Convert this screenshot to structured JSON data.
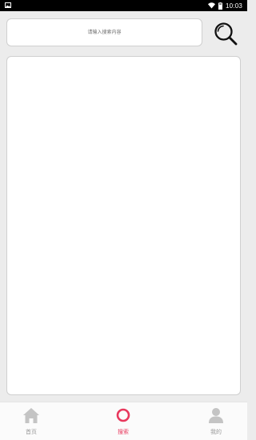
{
  "status_bar": {
    "time": "10:03",
    "icons": [
      "image-icon",
      "wifi-icon",
      "battery-icon"
    ]
  },
  "search": {
    "placeholder": "请输入搜索内容",
    "value": "",
    "button_icon": "search-icon"
  },
  "bottom_nav": {
    "items": [
      {
        "label": "首页",
        "icon": "home-icon",
        "active": false
      },
      {
        "label": "搜索",
        "icon": "search-ring-icon",
        "active": true
      },
      {
        "label": "我的",
        "icon": "user-icon",
        "active": false
      }
    ]
  },
  "colors": {
    "accent": "#e8385d",
    "inactive": "#9a9a9a",
    "background": "#ececec",
    "panel": "#ffffff"
  }
}
